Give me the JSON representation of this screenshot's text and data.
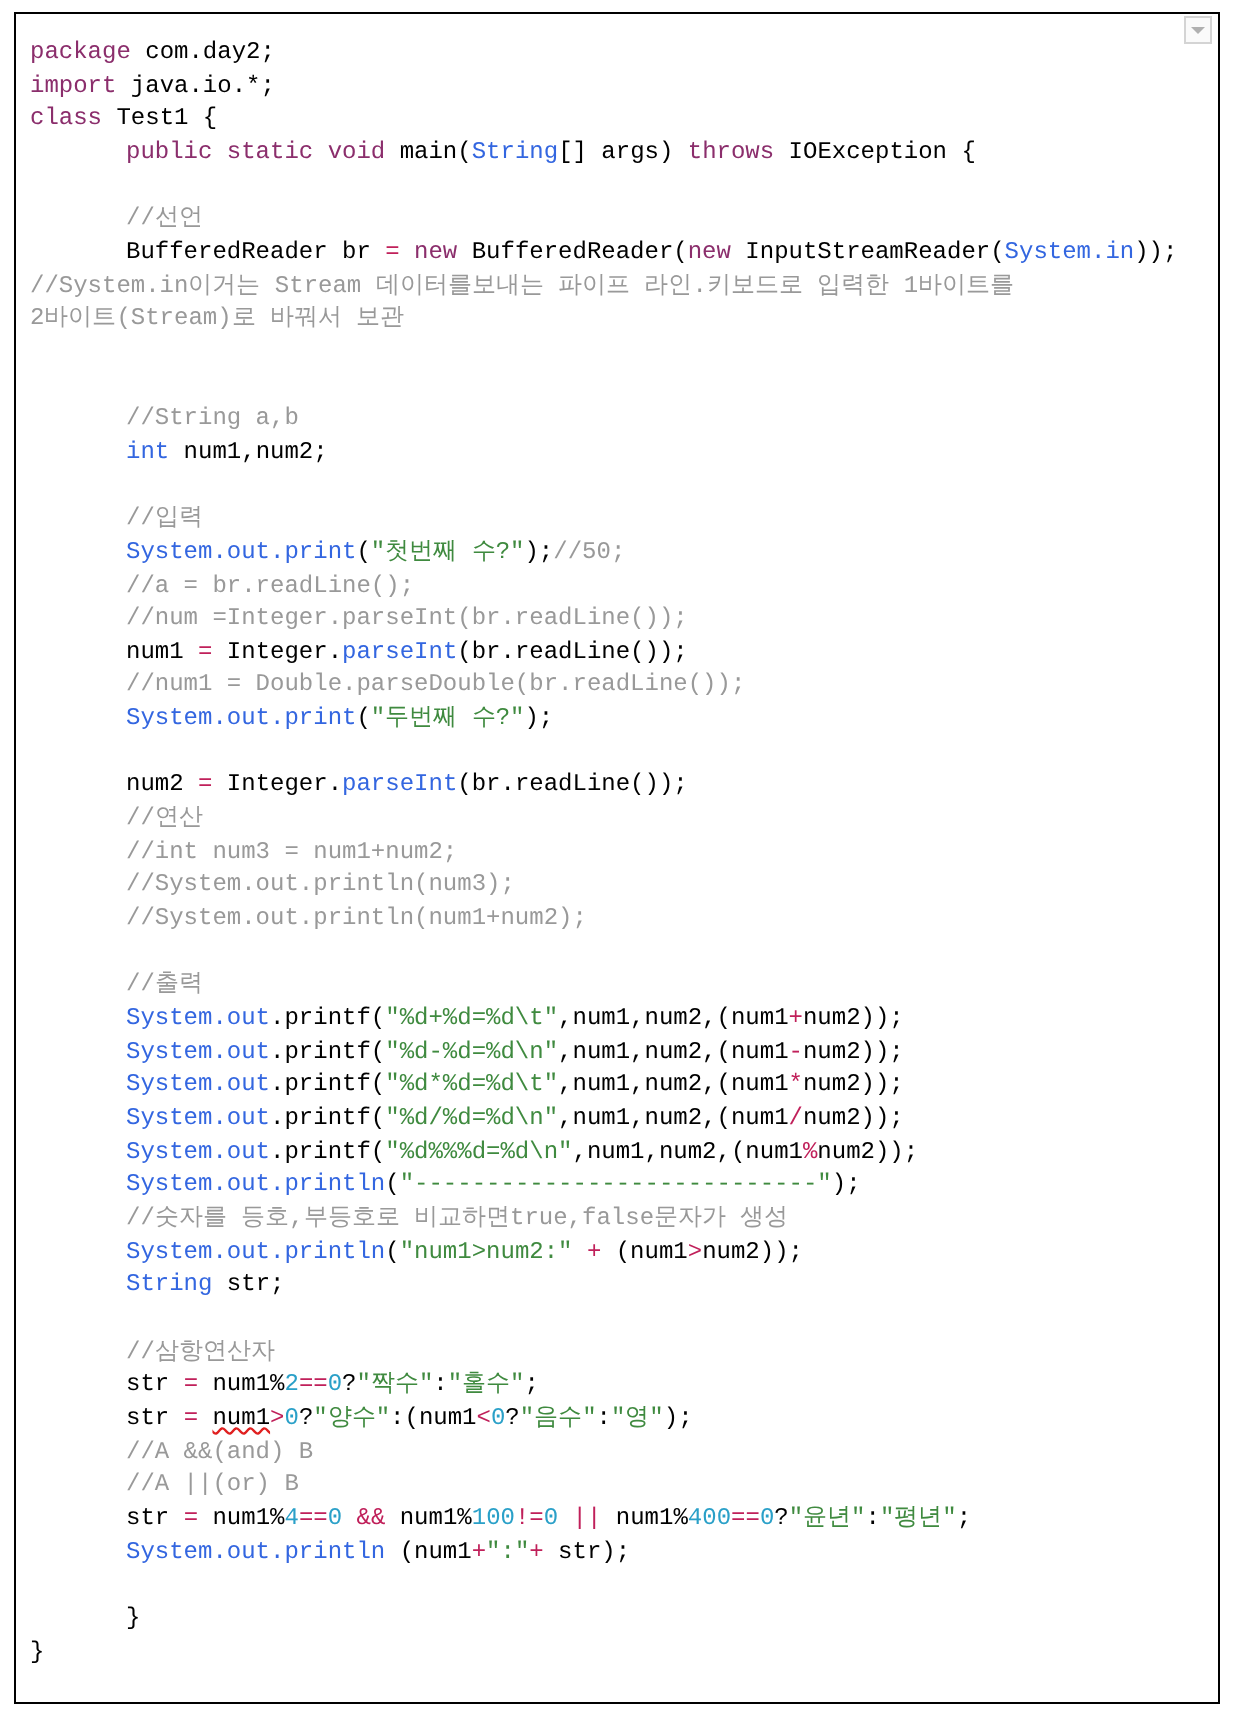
{
  "editor": {
    "lines": [
      {
        "kind": "code",
        "indented": false,
        "tokens": [
          {
            "kind": "keyword",
            "text": "package"
          },
          {
            "kind": "plain",
            "text": " com.day2;"
          }
        ]
      },
      {
        "kind": "code",
        "indented": false,
        "tokens": [
          {
            "kind": "keyword",
            "text": "import"
          },
          {
            "kind": "plain",
            "text": " java.io.*;"
          }
        ]
      },
      {
        "kind": "code",
        "indented": false,
        "tokens": [
          {
            "kind": "keyword",
            "text": "class"
          },
          {
            "kind": "plain",
            "text": " Test1 {"
          }
        ]
      },
      {
        "kind": "code",
        "indented": true,
        "tokens": [
          {
            "kind": "keyword",
            "text": "public static void"
          },
          {
            "kind": "plain",
            "text": " main("
          },
          {
            "kind": "type",
            "text": "String"
          },
          {
            "kind": "plain",
            "text": "[] args) "
          },
          {
            "kind": "keyword",
            "text": "throws"
          },
          {
            "kind": "plain",
            "text": " IOException {"
          }
        ]
      },
      {
        "kind": "blank"
      },
      {
        "kind": "code",
        "indented": true,
        "tokens": [
          {
            "kind": "comment",
            "text": "//선언"
          }
        ]
      },
      {
        "kind": "code",
        "indented": true,
        "tokens": [
          {
            "kind": "plain",
            "text": "BufferedReader br "
          },
          {
            "kind": "operator",
            "text": "= "
          },
          {
            "kind": "keyword",
            "text": "new"
          },
          {
            "kind": "plain",
            "text": " BufferedReader("
          },
          {
            "kind": "keyword",
            "text": "new"
          },
          {
            "kind": "plain",
            "text": " InputStreamReader("
          },
          {
            "kind": "type",
            "text": "System.in"
          },
          {
            "kind": "plain",
            "text": "));"
          }
        ]
      },
      {
        "kind": "code",
        "indented": false,
        "tokens": [
          {
            "kind": "comment",
            "text": "//System.in이거는 Stream 데이터를보내는 파이프 라인.키보드로 입력한 1바이트를"
          }
        ]
      },
      {
        "kind": "code",
        "indented": false,
        "tokens": [
          {
            "kind": "comment",
            "text": "2바이트(Stream)로 바꿔서 보관"
          }
        ]
      },
      {
        "kind": "blank"
      },
      {
        "kind": "blank"
      },
      {
        "kind": "code",
        "indented": true,
        "tokens": [
          {
            "kind": "comment",
            "text": "//String a,b"
          }
        ]
      },
      {
        "kind": "code",
        "indented": true,
        "tokens": [
          {
            "kind": "type",
            "text": "int"
          },
          {
            "kind": "plain",
            "text": " num1,num2;"
          }
        ]
      },
      {
        "kind": "blank"
      },
      {
        "kind": "code",
        "indented": true,
        "tokens": [
          {
            "kind": "comment",
            "text": "//입력"
          }
        ]
      },
      {
        "kind": "code",
        "indented": true,
        "tokens": [
          {
            "kind": "type",
            "text": "System.out.print"
          },
          {
            "kind": "plain",
            "text": "("
          },
          {
            "kind": "string",
            "text": "\"첫번째 수?\""
          },
          {
            "kind": "plain",
            "text": ");"
          },
          {
            "kind": "comment",
            "text": "//50;"
          }
        ]
      },
      {
        "kind": "code",
        "indented": true,
        "tokens": [
          {
            "kind": "comment",
            "text": "//a = br.readLine();"
          }
        ]
      },
      {
        "kind": "code",
        "indented": true,
        "tokens": [
          {
            "kind": "comment",
            "text": "//num =Integer.parseInt(br.readLine());"
          }
        ]
      },
      {
        "kind": "code",
        "indented": true,
        "tokens": [
          {
            "kind": "plain",
            "text": "num1 "
          },
          {
            "kind": "operator",
            "text": "="
          },
          {
            "kind": "plain",
            "text": " Integer."
          },
          {
            "kind": "type",
            "text": "parseInt"
          },
          {
            "kind": "plain",
            "text": "(br.readLine());"
          }
        ]
      },
      {
        "kind": "code",
        "indented": true,
        "tokens": [
          {
            "kind": "comment",
            "text": "//num1 = Double.parseDouble(br.readLine());"
          }
        ]
      },
      {
        "kind": "code",
        "indented": true,
        "tokens": [
          {
            "kind": "type",
            "text": "System.out.print"
          },
          {
            "kind": "plain",
            "text": "("
          },
          {
            "kind": "string",
            "text": "\"두번째 수?\""
          },
          {
            "kind": "plain",
            "text": ");"
          }
        ]
      },
      {
        "kind": "blank"
      },
      {
        "kind": "code",
        "indented": true,
        "tokens": [
          {
            "kind": "plain",
            "text": "num2 "
          },
          {
            "kind": "operator",
            "text": "="
          },
          {
            "kind": "plain",
            "text": " Integer."
          },
          {
            "kind": "type",
            "text": "parseInt"
          },
          {
            "kind": "plain",
            "text": "(br.readLine());"
          }
        ]
      },
      {
        "kind": "code",
        "indented": true,
        "tokens": [
          {
            "kind": "comment",
            "text": "//연산"
          }
        ]
      },
      {
        "kind": "code",
        "indented": true,
        "tokens": [
          {
            "kind": "comment",
            "text": "//int num3 = num1+num2;"
          }
        ]
      },
      {
        "kind": "code",
        "indented": true,
        "tokens": [
          {
            "kind": "comment",
            "text": "//System.out.println(num3);"
          }
        ]
      },
      {
        "kind": "code",
        "indented": true,
        "tokens": [
          {
            "kind": "comment",
            "text": "//System.out.println(num1+num2);"
          }
        ]
      },
      {
        "kind": "blank"
      },
      {
        "kind": "code",
        "indented": true,
        "tokens": [
          {
            "kind": "comment",
            "text": "//출력"
          }
        ]
      },
      {
        "kind": "code",
        "indented": true,
        "tokens": [
          {
            "kind": "type",
            "text": "System.out"
          },
          {
            "kind": "plain",
            "text": ".printf("
          },
          {
            "kind": "string",
            "text": "\"%d+%d=%d\\t\""
          },
          {
            "kind": "plain",
            "text": ",num1,num2,(num1"
          },
          {
            "kind": "operator",
            "text": "+"
          },
          {
            "kind": "plain",
            "text": "num2));"
          }
        ]
      },
      {
        "kind": "code",
        "indented": true,
        "tokens": [
          {
            "kind": "type",
            "text": "System.out"
          },
          {
            "kind": "plain",
            "text": ".printf("
          },
          {
            "kind": "string",
            "text": "\"%d-%d=%d\\n\""
          },
          {
            "kind": "plain",
            "text": ",num1,num2,(num1"
          },
          {
            "kind": "operator",
            "text": "-"
          },
          {
            "kind": "plain",
            "text": "num2));"
          }
        ]
      },
      {
        "kind": "code",
        "indented": true,
        "tokens": [
          {
            "kind": "type",
            "text": "System.out"
          },
          {
            "kind": "plain",
            "text": ".printf("
          },
          {
            "kind": "string",
            "text": "\"%d*%d=%d\\t\""
          },
          {
            "kind": "plain",
            "text": ",num1,num2,(num1"
          },
          {
            "kind": "operator",
            "text": "*"
          },
          {
            "kind": "plain",
            "text": "num2));"
          }
        ]
      },
      {
        "kind": "code",
        "indented": true,
        "tokens": [
          {
            "kind": "type",
            "text": "System.out"
          },
          {
            "kind": "plain",
            "text": ".printf("
          },
          {
            "kind": "string",
            "text": "\"%d/%d=%d\\n\""
          },
          {
            "kind": "plain",
            "text": ",num1,num2,(num1"
          },
          {
            "kind": "operator",
            "text": "/"
          },
          {
            "kind": "plain",
            "text": "num2));"
          }
        ]
      },
      {
        "kind": "code",
        "indented": true,
        "tokens": [
          {
            "kind": "type",
            "text": "System.out"
          },
          {
            "kind": "plain",
            "text": ".printf("
          },
          {
            "kind": "string",
            "text": "\"%d%%%d=%d\\n\""
          },
          {
            "kind": "plain",
            "text": ",num1,num2,(num1"
          },
          {
            "kind": "operator",
            "text": "%"
          },
          {
            "kind": "plain",
            "text": "num2));"
          }
        ]
      },
      {
        "kind": "code",
        "indented": true,
        "tokens": [
          {
            "kind": "type",
            "text": "System.out.println"
          },
          {
            "kind": "plain",
            "text": "("
          },
          {
            "kind": "string",
            "text": "\"----------------------------\""
          },
          {
            "kind": "plain",
            "text": ");"
          }
        ]
      },
      {
        "kind": "code",
        "indented": true,
        "tokens": [
          {
            "kind": "comment",
            "text": "//숫자를 등호,부등호로 비교하면true,false문자가 생성"
          }
        ]
      },
      {
        "kind": "code",
        "indented": true,
        "tokens": [
          {
            "kind": "type",
            "text": "System.out.println"
          },
          {
            "kind": "plain",
            "text": "("
          },
          {
            "kind": "string",
            "text": "\"num1>num2:\""
          },
          {
            "kind": "operator",
            "text": " +"
          },
          {
            "kind": "plain",
            "text": " (num1"
          },
          {
            "kind": "operator",
            "text": ">"
          },
          {
            "kind": "plain",
            "text": "num2));"
          }
        ]
      },
      {
        "kind": "code",
        "indented": true,
        "tokens": [
          {
            "kind": "type",
            "text": "String"
          },
          {
            "kind": "plain",
            "text": " str;"
          }
        ]
      },
      {
        "kind": "blank"
      },
      {
        "kind": "code",
        "indented": true,
        "tokens": [
          {
            "kind": "comment",
            "text": "//삼항연산자"
          }
        ]
      },
      {
        "kind": "code",
        "indented": true,
        "tokens": [
          {
            "kind": "plain",
            "text": "str "
          },
          {
            "kind": "operator",
            "text": "="
          },
          {
            "kind": "plain",
            "text": " num1%"
          },
          {
            "kind": "number",
            "text": "2"
          },
          {
            "kind": "operator",
            "text": "=="
          },
          {
            "kind": "number",
            "text": "0"
          },
          {
            "kind": "plain",
            "text": "?"
          },
          {
            "kind": "string",
            "text": "\"짝수\""
          },
          {
            "kind": "plain",
            "text": ":"
          },
          {
            "kind": "string",
            "text": "\"홀수\""
          },
          {
            "kind": "plain",
            "text": ";"
          }
        ]
      },
      {
        "kind": "code",
        "indented": true,
        "tokens": [
          {
            "kind": "plain",
            "text": "str "
          },
          {
            "kind": "operator",
            "text": "= "
          },
          {
            "kind": "misspelled",
            "text": "num1"
          },
          {
            "kind": "operator",
            "text": ">"
          },
          {
            "kind": "number",
            "text": "0"
          },
          {
            "kind": "plain",
            "text": "?"
          },
          {
            "kind": "string",
            "text": "\"양수\""
          },
          {
            "kind": "plain",
            "text": ":(num1"
          },
          {
            "kind": "operator",
            "text": "<"
          },
          {
            "kind": "number",
            "text": "0"
          },
          {
            "kind": "plain",
            "text": "?"
          },
          {
            "kind": "string",
            "text": "\"음수\""
          },
          {
            "kind": "plain",
            "text": ":"
          },
          {
            "kind": "string",
            "text": "\"영\""
          },
          {
            "kind": "plain",
            "text": ");"
          }
        ]
      },
      {
        "kind": "code",
        "indented": true,
        "tokens": [
          {
            "kind": "comment",
            "text": "//A &&(and) B"
          }
        ]
      },
      {
        "kind": "code",
        "indented": true,
        "tokens": [
          {
            "kind": "comment",
            "text": "//A ||(or) B"
          }
        ]
      },
      {
        "kind": "code",
        "indented": true,
        "tokens": [
          {
            "kind": "plain",
            "text": "str "
          },
          {
            "kind": "operator",
            "text": "="
          },
          {
            "kind": "plain",
            "text": " num1%"
          },
          {
            "kind": "number",
            "text": "4"
          },
          {
            "kind": "operator",
            "text": "=="
          },
          {
            "kind": "number",
            "text": "0"
          },
          {
            "kind": "operator",
            "text": " &&"
          },
          {
            "kind": "plain",
            "text": " num1%"
          },
          {
            "kind": "number",
            "text": "100"
          },
          {
            "kind": "operator",
            "text": "!="
          },
          {
            "kind": "number",
            "text": "0"
          },
          {
            "kind": "operator",
            "text": " ||"
          },
          {
            "kind": "plain",
            "text": " num1%"
          },
          {
            "kind": "number",
            "text": "400"
          },
          {
            "kind": "operator",
            "text": "=="
          },
          {
            "kind": "number",
            "text": "0"
          },
          {
            "kind": "plain",
            "text": "?"
          },
          {
            "kind": "string",
            "text": "\"윤년\""
          },
          {
            "kind": "plain",
            "text": ":"
          },
          {
            "kind": "string",
            "text": "\"평년\""
          },
          {
            "kind": "plain",
            "text": ";"
          }
        ]
      },
      {
        "kind": "code",
        "indented": true,
        "tokens": [
          {
            "kind": "type",
            "text": "System.out.println"
          },
          {
            "kind": "plain",
            "text": " (num1"
          },
          {
            "kind": "operator",
            "text": "+"
          },
          {
            "kind": "string",
            "text": "\":\""
          },
          {
            "kind": "operator",
            "text": "+"
          },
          {
            "kind": "plain",
            "text": " str);"
          }
        ]
      },
      {
        "kind": "blank"
      },
      {
        "kind": "code",
        "indented": true,
        "tokens": [
          {
            "kind": "plain",
            "text": "}"
          }
        ]
      },
      {
        "kind": "code",
        "indented": false,
        "tokens": [
          {
            "kind": "plain",
            "text": "}"
          }
        ]
      }
    ]
  }
}
